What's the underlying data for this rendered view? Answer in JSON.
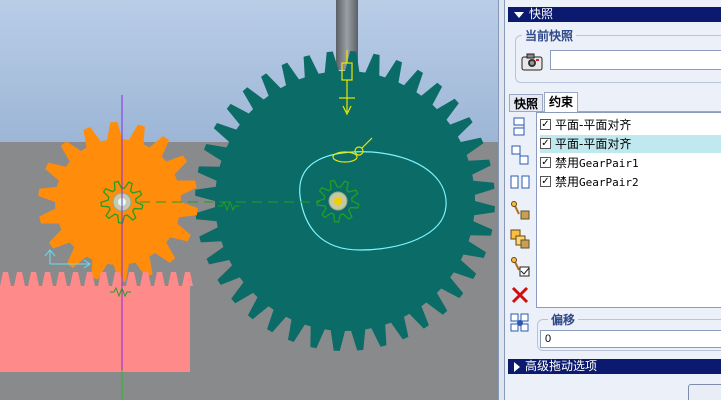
{
  "panel": {
    "header_label": "快照",
    "current_snapshot": {
      "title": "当前快照",
      "name_value": ""
    },
    "tabs": [
      {
        "label": "快照",
        "active": false
      },
      {
        "label": "约束",
        "active": true
      }
    ],
    "constraints": [
      {
        "label": "平面-平面对齐",
        "checked": true,
        "selected": false,
        "mono": false
      },
      {
        "label": "平面-平面对齐",
        "checked": true,
        "selected": true,
        "mono": false
      },
      {
        "label_prefix": "禁用",
        "label_suffix": "GearPair1",
        "checked": true,
        "selected": false,
        "mono": true
      },
      {
        "label_prefix": "禁用",
        "label_suffix": "GearPair2",
        "checked": true,
        "selected": false,
        "mono": true
      }
    ],
    "offset": {
      "title": "偏移",
      "value": "0"
    },
    "advanced_label": "高级拖动选项"
  },
  "colors": {
    "accent_bar": "#0b1a6e",
    "large_gear": "#0b6b66",
    "small_gear": "#ff8c0a",
    "rack": "#ff8a8a",
    "selection": "#bfe9ef"
  },
  "icons": [
    "snapshot-camera-icon",
    "align-constraint-icon",
    "mate-constraint-icon",
    "separate-icon",
    "lock-body-icon",
    "enable-connection-icon",
    "disable-connection-icon",
    "delete-icon",
    "offset-icon"
  ]
}
